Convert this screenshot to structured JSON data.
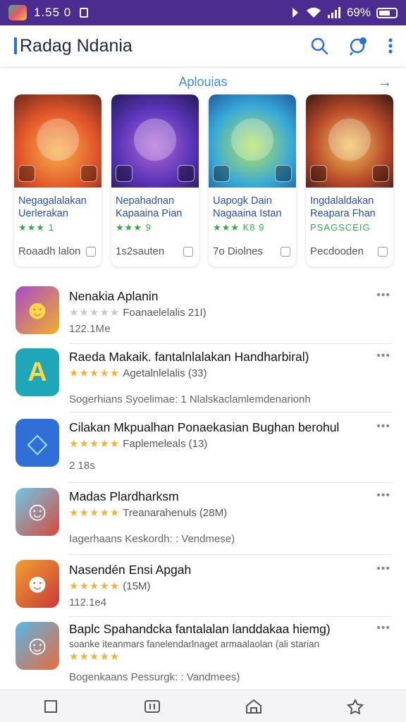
{
  "status_bar": {
    "time": "1.55 0",
    "battery": "69%",
    "battery_level": 0.69
  },
  "app_bar": {
    "title": "Radag Ndania"
  },
  "featured": {
    "title": "Aplouias",
    "cards": [
      {
        "name_line1": "Negagalalakan",
        "name_line2": "Uerlerakan",
        "rating_text": "★★★ 1",
        "footer": "Roaadh lalon"
      },
      {
        "name_line1": "Nepahadnan",
        "name_line2": "Kapaaina Pian",
        "rating_text": "★★★ 9",
        "footer": "1s2sauten"
      },
      {
        "name_line1": "Uapogk Dain",
        "name_line2": "Nagaaina Istan",
        "rating_text": "★★★ K8 9",
        "footer": "7o Diolnes"
      },
      {
        "name_line1": "Ingdalaldakan",
        "name_line2": "Reapara Fhan",
        "rating_text": "PSAGSCEIG",
        "footer": "Pecdooden"
      }
    ]
  },
  "list": [
    {
      "title": "Nenakia Aplanin",
      "stars": "★★★★★",
      "meta": "Foanaelelalis  21I)",
      "extra": "122.1Ме"
    },
    {
      "title": "Raeda Makaik. fantalnlalakan Handharbiral)",
      "stars": "★★★★★",
      "meta": "Agetalnlelalis  (33)",
      "extra": "Sogerhians    Syoelimae:  1 Nlalskaclamlemdenarionh"
    },
    {
      "title": "Cilakan Mkpualhan Ponaekasian Bughan berohul",
      "stars": "★★★★★",
      "meta": "Faplemeleals  (13)",
      "extra": "2 18s"
    },
    {
      "title": "Madas Plardharksm",
      "stars": "★★★★★",
      "meta": "Treanarahenuls  (28M)",
      "extra": "Iagerhaans    Keskordh:  :  Vendmese)"
    },
    {
      "title": "Nasendén Ensi Apgah",
      "stars": "★★★★★",
      "meta": "(15M)",
      "extra": "112.1e4"
    },
    {
      "title": "Baplc Spahandcka fantalalan landdakaa hiemg)",
      "stars": "★★★★★",
      "meta": "soanke iteanmars fanelendarlnaget armaalaolan (ali starian",
      "extra": "Bogenkaans    Pessurgk:  :  Vandmees)"
    }
  ]
}
